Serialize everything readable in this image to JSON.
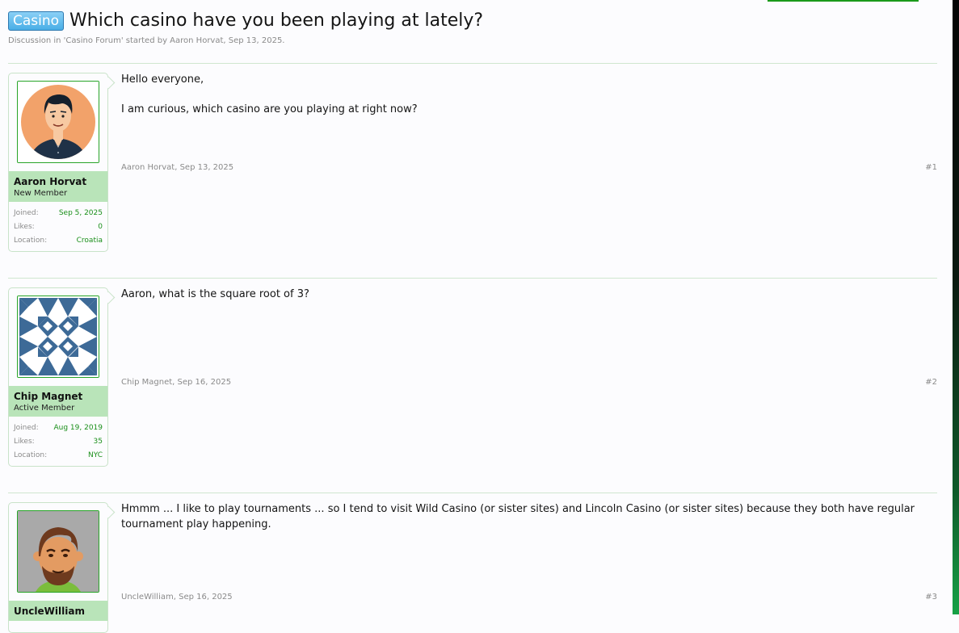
{
  "thread": {
    "prefix": "Casino",
    "title": "Which casino have you been playing at lately?",
    "meta": "Discussion in 'Casino Forum' started by Aaron Horvat, Sep 13, 2025."
  },
  "labels": {
    "joined": "Joined:",
    "likes": "Likes:",
    "location": "Location:"
  },
  "posts": [
    {
      "user": {
        "name": "Aaron Horvat",
        "title": "New Member",
        "joined": "Sep 5, 2025",
        "likes": "0",
        "location": "Croatia"
      },
      "message": [
        "Hello everyone,",
        "I am curious, which casino are you playing at right now?"
      ],
      "footer": "Aaron Horvat, Sep 13, 2025",
      "number": "#1"
    },
    {
      "user": {
        "name": "Chip Magnet",
        "title": "Active Member",
        "joined": "Aug 19, 2019",
        "likes": "35",
        "location": "NYC"
      },
      "message": [
        "Aaron, what is the square root of 3?"
      ],
      "footer": "Chip Magnet, Sep 16, 2025",
      "number": "#2"
    },
    {
      "user": {
        "name": "UncleWilliam"
      },
      "message": [
        "Hmmm ... I like to play tournaments ... so I tend to visit Wild Casino (or sister sites) and Lincoln Casino (or sister sites) because they both have regular tournament play happening."
      ],
      "footer": "UncleWilliam, Sep 16, 2025",
      "number": "#3"
    }
  ],
  "colors": {
    "accent": "#1a8f1a",
    "user_block": "#b9e4b9",
    "prefix": "#49aee6"
  }
}
